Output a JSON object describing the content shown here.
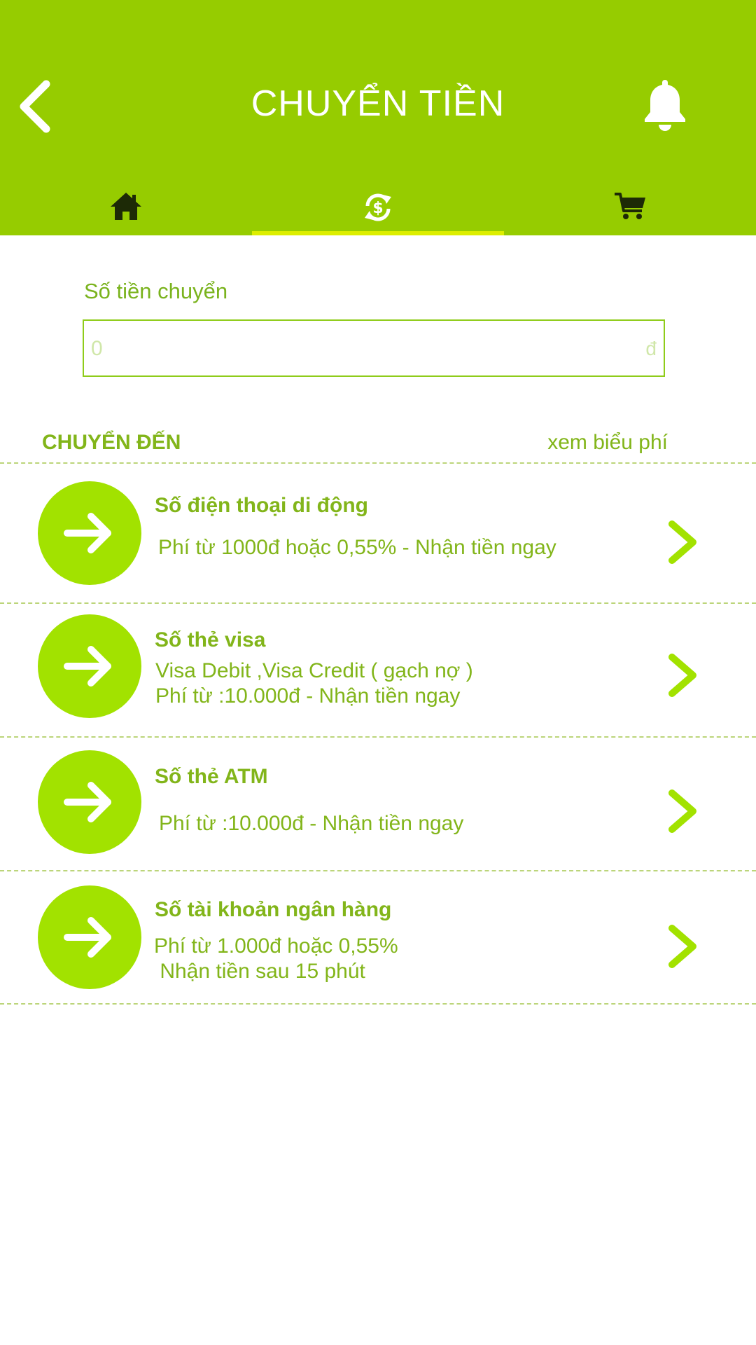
{
  "header": {
    "title": "CHUYỂN TIỀN",
    "tabs": [
      {
        "icon": "home-icon"
      },
      {
        "icon": "transfer-icon",
        "active": true
      },
      {
        "icon": "cart-icon"
      }
    ]
  },
  "amount": {
    "label": "Số tiền chuyển",
    "placeholder": "0",
    "currency": "đ"
  },
  "section": {
    "title": "CHUYỂN ĐẾN",
    "fee_link": "xem biểu phí"
  },
  "items": [
    {
      "title": "Số điện thoại di động",
      "lines": [
        "Phí từ 1000đ hoặc 0,55% - Nhận tiền ngay"
      ]
    },
    {
      "title": "Số thẻ visa",
      "lines": [
        "Visa Debit ,Visa Credit ( gạch nợ )",
        "Phí từ :10.000đ - Nhận tiền ngay"
      ]
    },
    {
      "title": "Số thẻ ATM",
      "lines": [
        "Phí từ :10.000đ - Nhận tiền ngay"
      ]
    },
    {
      "title": "Số tài khoản ngân hàng",
      "lines": [
        "Phí từ 1.000đ hoặc 0,55%",
        " Nhận tiền sau 15 phút"
      ]
    }
  ],
  "colors": {
    "header_bg": "#96cc00",
    "accent": "#82b51a",
    "circle": "#a2e200",
    "tab_indicator": "#ddee00"
  }
}
